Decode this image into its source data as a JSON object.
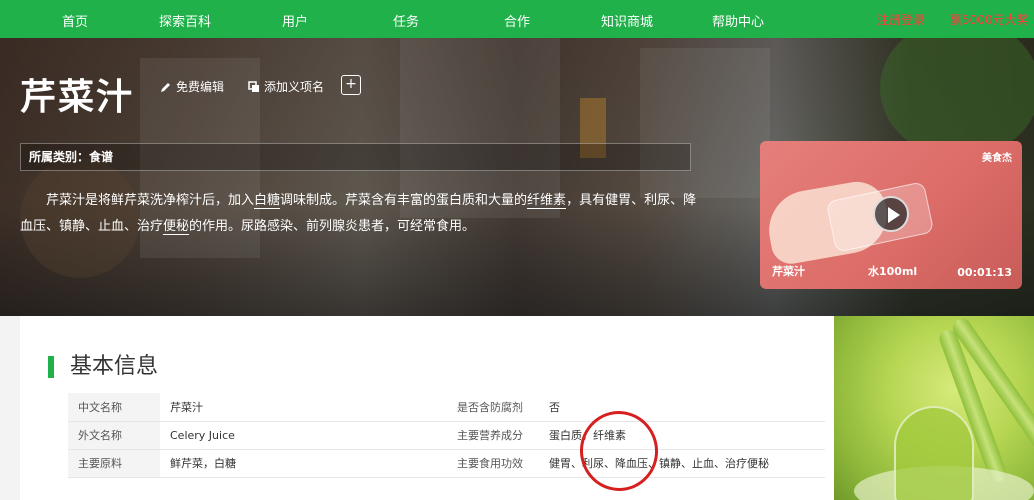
{
  "nav": {
    "items": [
      "首页",
      "探索百科",
      "用户",
      "任务",
      "合作",
      "知识商城",
      "帮助中心"
    ],
    "right_items": [
      "注册登录",
      "赢5000元大奖"
    ]
  },
  "entry": {
    "title": "芹菜汁",
    "actions": {
      "edit": "免费编辑",
      "add_meaning": "添加义项名"
    },
    "category": "所属类别：食谱",
    "summary_parts": [
      "芹菜汁是将鲜芹菜洗净榨汁后，加入",
      "白糖",
      "调味制成。芹菜含有丰富的蛋白质和大量的",
      "纤维素",
      "，具有健胃、利尿、降血压、镇静、止血、治疗",
      "便秘",
      "的作用。尿路感染、前列腺炎患者，可经常食用。"
    ]
  },
  "video": {
    "logo": "美食杰",
    "caption_left": "芹菜汁",
    "caption_mid": "水100ml",
    "duration": "00:01:13"
  },
  "basic_info": {
    "heading": "基本信息",
    "rows": [
      {
        "k1": "中文名称",
        "v1": "芹菜汁",
        "k2": "是否含防腐剂",
        "v2": "否"
      },
      {
        "k1": "外文名称",
        "v1": "Celery Juice",
        "k2": "主要营养成分",
        "v2": "蛋白质，纤维素"
      },
      {
        "k1": "主要原料",
        "v1": "鲜芹菜，白糖",
        "k2": "主要食用功效",
        "v2": "健胃、利尿、降血压、镇静、止血、治疗便秘"
      }
    ]
  },
  "colors": {
    "brand_green": "#20b14a",
    "annotation_red": "#d62020"
  }
}
